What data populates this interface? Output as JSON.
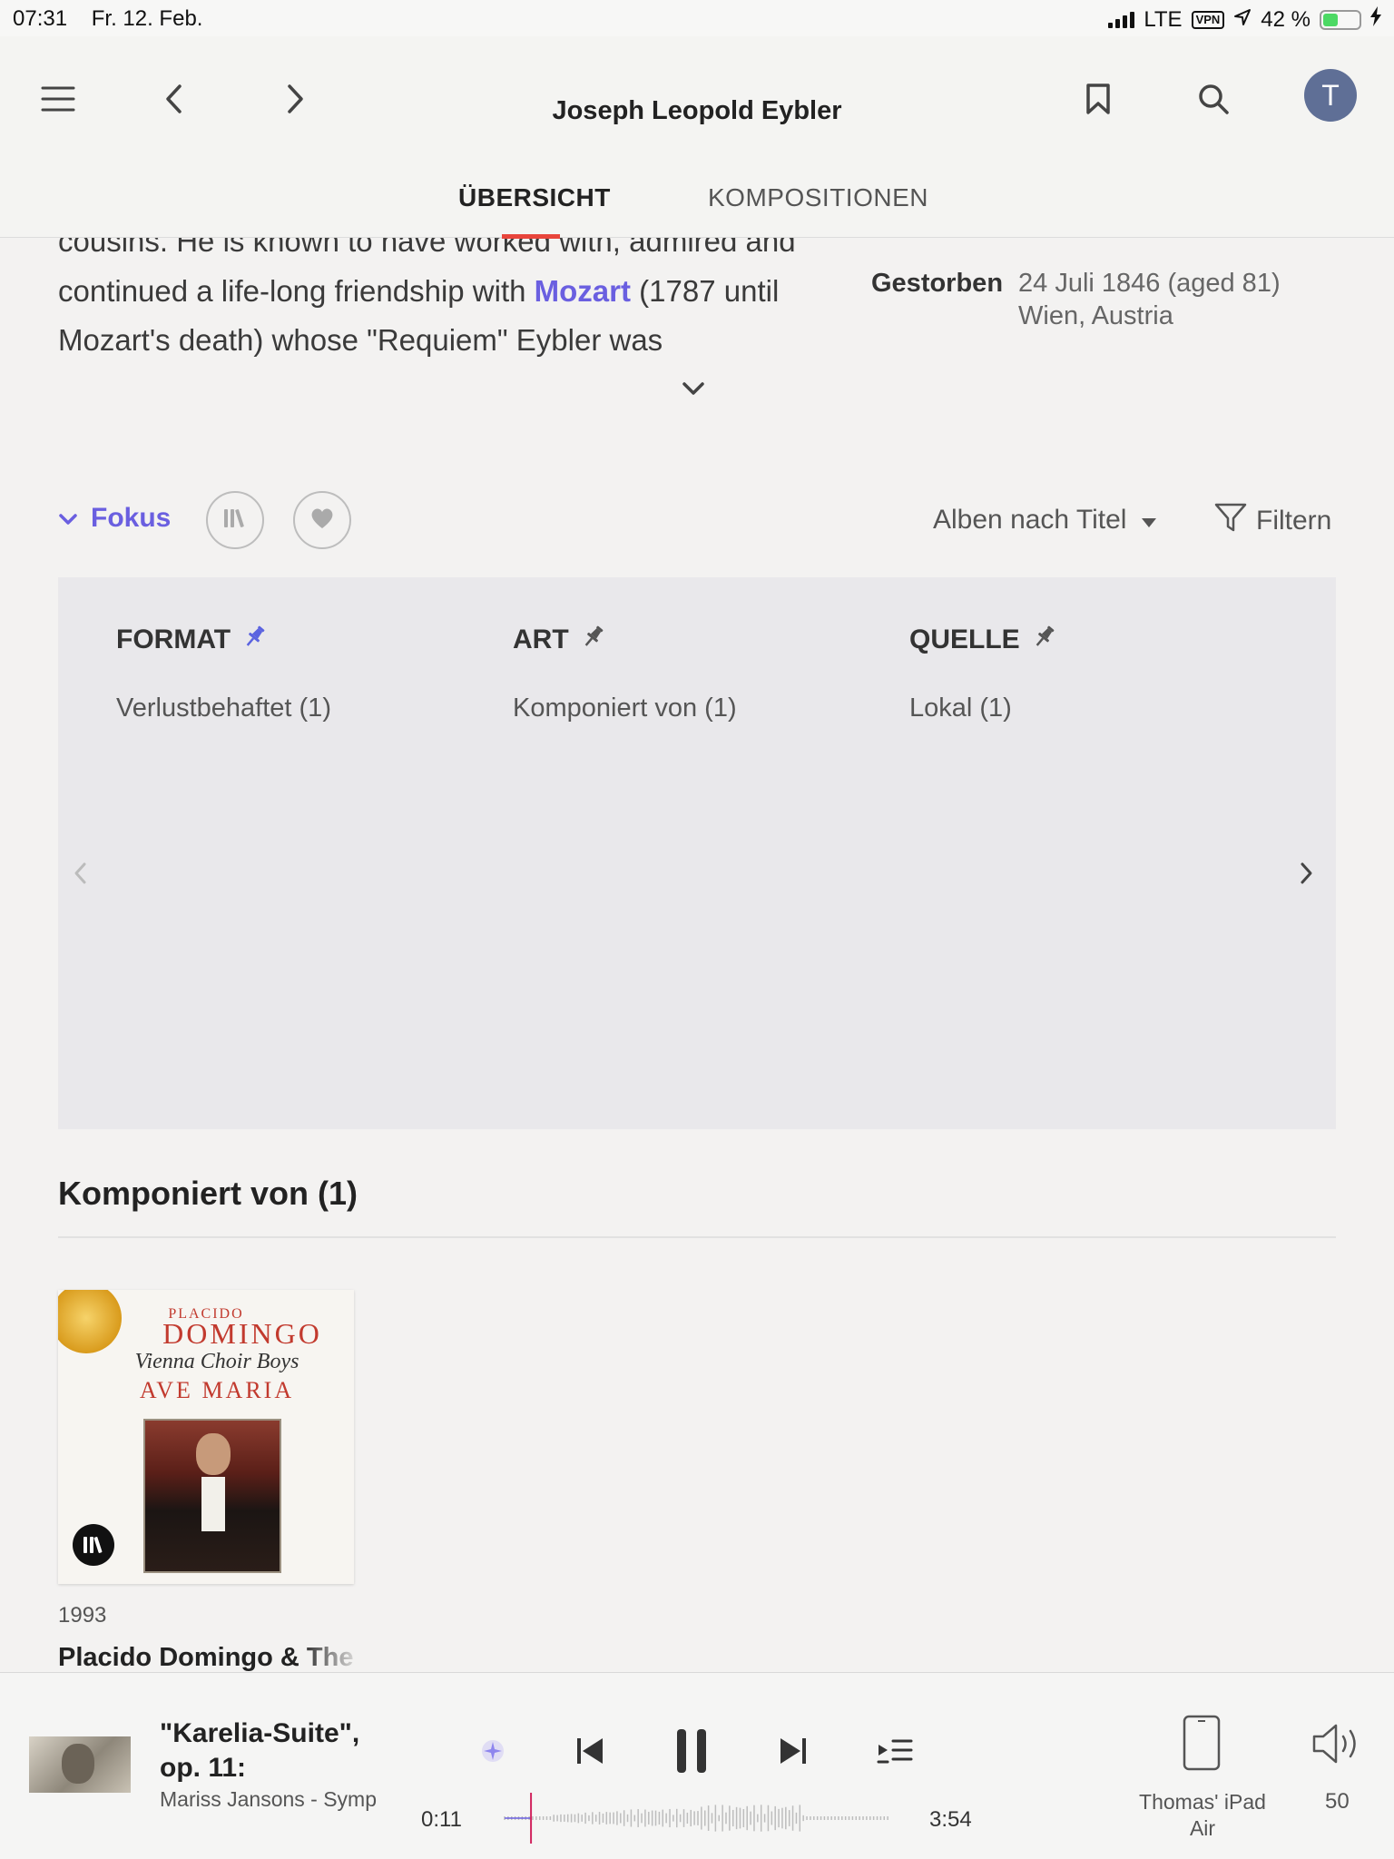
{
  "status_bar": {
    "time": "07:31",
    "date": "Fr. 12. Feb.",
    "network": "LTE",
    "vpn": "VPN",
    "battery": "42 %",
    "battery_level": 0.42
  },
  "header": {
    "title": "Joseph Leopold Eybler",
    "avatar_initial": "T",
    "tabs": [
      {
        "label": "ÜBERSICHT",
        "active": true
      },
      {
        "label": "KOMPOSITIONEN",
        "active": false
      }
    ]
  },
  "bio": {
    "line1": "cousins. He is known to have worked with, admired and",
    "line2_before": "continued a life-long friendship with ",
    "line2_link": "Mozart",
    "line2_after": " (1787 until",
    "line3": "Mozart's death) whose \"Requiem\" Eybler was",
    "died_label": "Gestorben",
    "died_date": "24 Juli 1846 (aged 81)",
    "died_place": "Wien, Austria"
  },
  "toolbar": {
    "focus_label": "Fokus",
    "sort_label": "Alben nach Titel",
    "filter_label": "Filtern"
  },
  "filter_panel": {
    "columns": [
      {
        "header": "FORMAT",
        "pinned": true,
        "item": "Verlustbehaftet (1)"
      },
      {
        "header": "ART",
        "pinned": false,
        "item": "Komponiert von (1)"
      },
      {
        "header": "QUELLE",
        "pinned": false,
        "item": "Lokal (1)"
      }
    ]
  },
  "results": {
    "section_title": "Komponiert von (1)",
    "albums": [
      {
        "year": "1993",
        "title": "Placido Domingo & The Vienna Choir Boys",
        "cover_text": {
          "line1": "PLACIDO",
          "line2": "DOMINGO",
          "line3": "Vienna Choir Boys",
          "line4": "AVE MARIA"
        }
      }
    ]
  },
  "player": {
    "track_title": "\"Karelia-Suite\", op. 11:",
    "track_artist": "Mariss Jansons - Symphony Orchestra",
    "time_current": "0:11",
    "time_total": "3:54",
    "progress": 0.047,
    "device": "Thomas' iPad Air",
    "volume": "50"
  },
  "colors": {
    "accent": "#6a5fe0",
    "tab_underline": "#e8453c",
    "pin_active": "#5b63e0",
    "avatar": "#5f6f96"
  }
}
